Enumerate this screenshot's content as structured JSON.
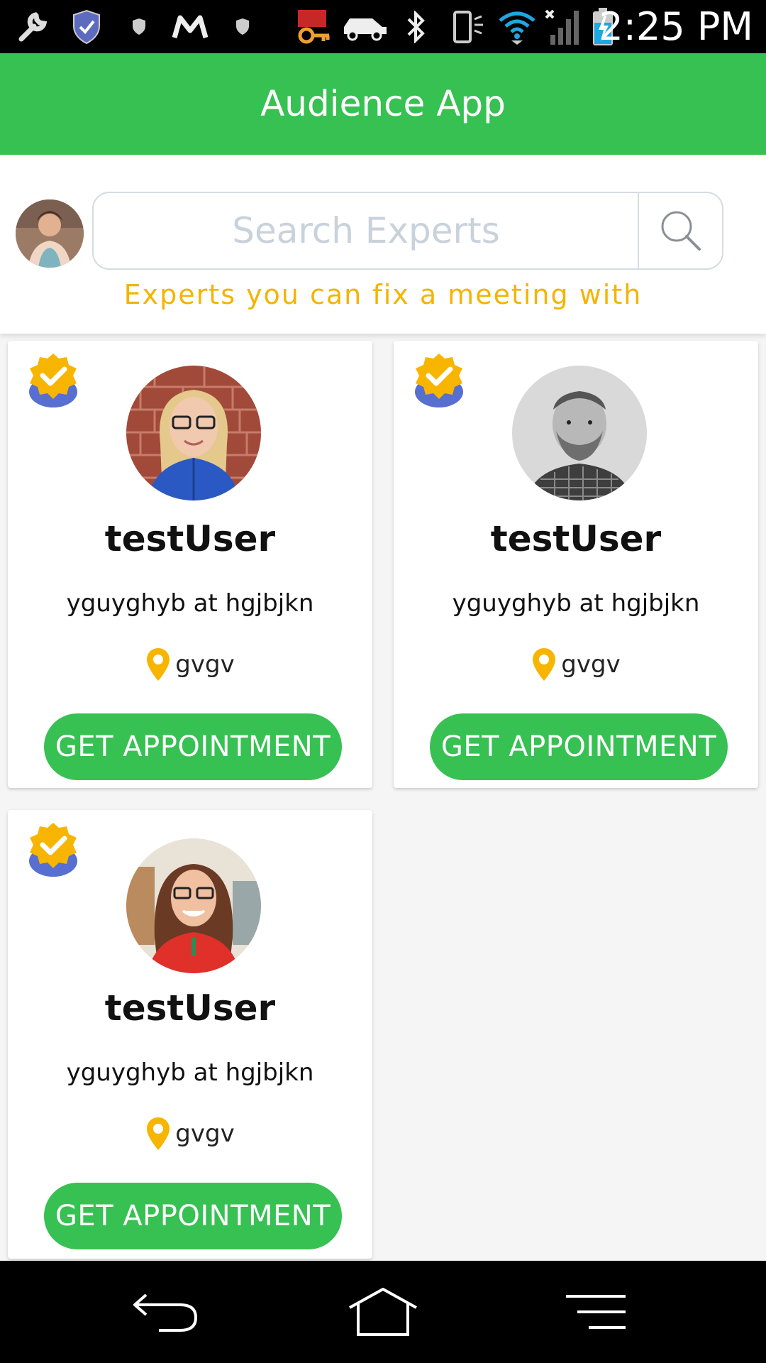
{
  "status_bar": {
    "time": "2:25 PM",
    "icons": [
      "wrench-icon",
      "shield-check-icon",
      "shield-small-icon",
      "m-logo-icon",
      "shield-small-icon",
      "key-icon",
      "car-icon",
      "bluetooth-icon",
      "vibrate-icon",
      "wifi-icon",
      "signal-icon",
      "battery-charging-icon"
    ]
  },
  "app_bar": {
    "title": "Audience App"
  },
  "search": {
    "placeholder": "Search Experts",
    "subtitle": "Experts you can fix a meeting with"
  },
  "experts": [
    {
      "name": "testUser",
      "role": "yguyghyb at hgjbjkn",
      "location": "gvgv",
      "button": "GET APPOINTMENT",
      "verified": true
    },
    {
      "name": "testUser",
      "role": "yguyghyb at hgjbjkn",
      "location": "gvgv",
      "button": "GET APPOINTMENT",
      "verified": true
    },
    {
      "name": "testUser",
      "role": "yguyghyb at hgjbjkn",
      "location": "gvgv",
      "button": "GET APPOINTMENT",
      "verified": true
    }
  ],
  "nav_bar": {
    "icons": [
      "back-icon",
      "home-icon",
      "menu-icon"
    ]
  },
  "colors": {
    "primary": "#36c152",
    "accent": "#f4b400",
    "placeholder": "#c9d2db"
  }
}
